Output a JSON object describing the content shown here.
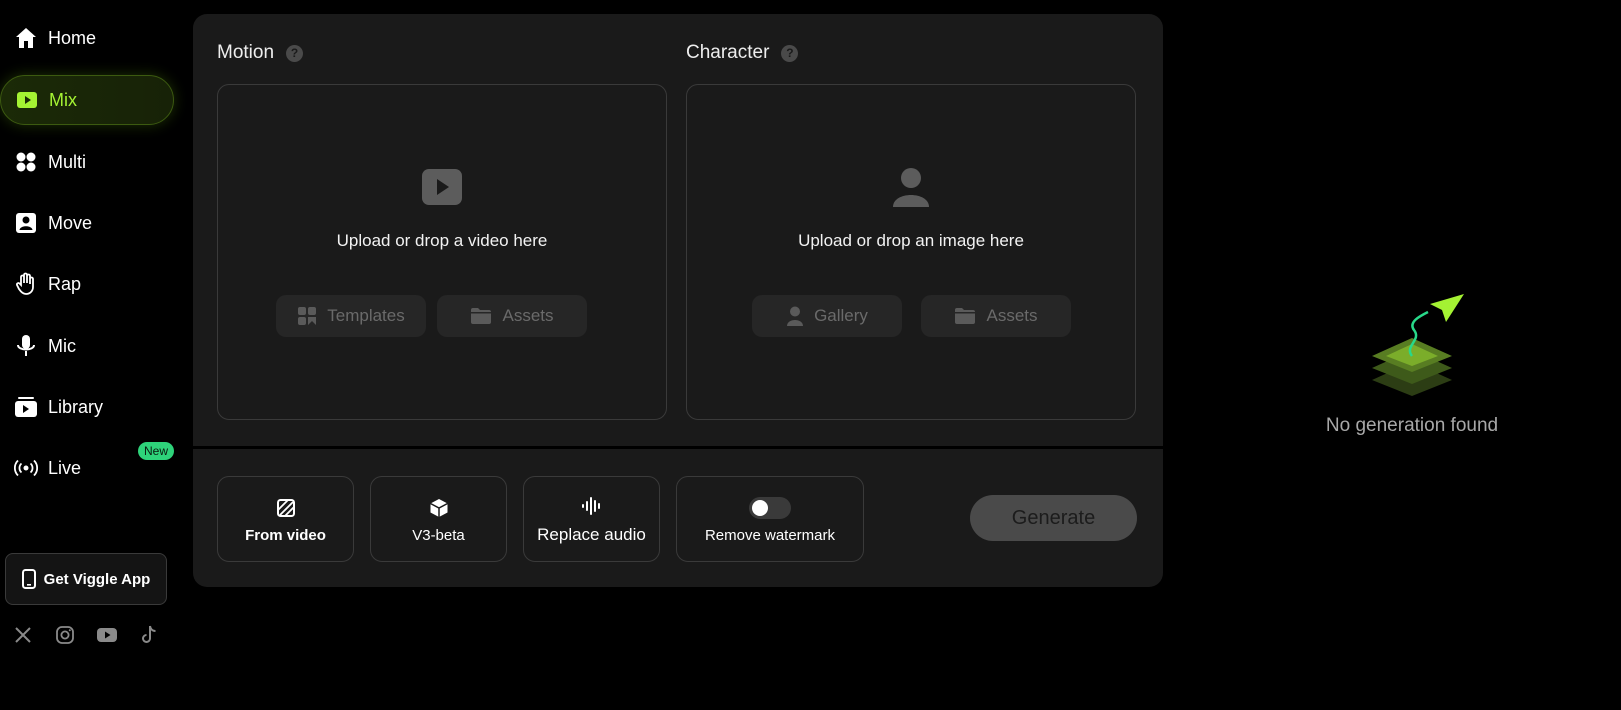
{
  "sidebar": {
    "items": [
      {
        "label": "Home",
        "icon": "home-icon"
      },
      {
        "label": "Mix",
        "icon": "play-square-icon",
        "active": true
      },
      {
        "label": "Multi",
        "icon": "multi-dots-icon"
      },
      {
        "label": "Move",
        "icon": "person-card-icon"
      },
      {
        "label": "Rap",
        "icon": "hand-icon"
      },
      {
        "label": "Mic",
        "icon": "mic-icon"
      },
      {
        "label": "Library",
        "icon": "library-icon"
      },
      {
        "label": "Live",
        "icon": "broadcast-icon",
        "badge": "New"
      }
    ],
    "app_button": "Get Viggle App",
    "socials": [
      "x-icon",
      "instagram-icon",
      "youtube-icon",
      "tiktok-icon"
    ]
  },
  "motion": {
    "title": "Motion",
    "prompt": "Upload or drop a video here",
    "templates_label": "Templates",
    "assets_label": "Assets"
  },
  "character": {
    "title": "Character",
    "prompt": "Upload or drop an image here",
    "gallery_label": "Gallery",
    "assets_label": "Assets"
  },
  "options": {
    "from_video": "From video",
    "v3_beta": "V3-beta",
    "replace_audio": "Replace audio",
    "remove_watermark": "Remove watermark",
    "watermark_toggle": false
  },
  "generate_label": "Generate",
  "empty_state": "No generation found",
  "colors": {
    "accent": "#a4f233",
    "badge": "#2ed37a",
    "panel": "#1a1a1a"
  }
}
